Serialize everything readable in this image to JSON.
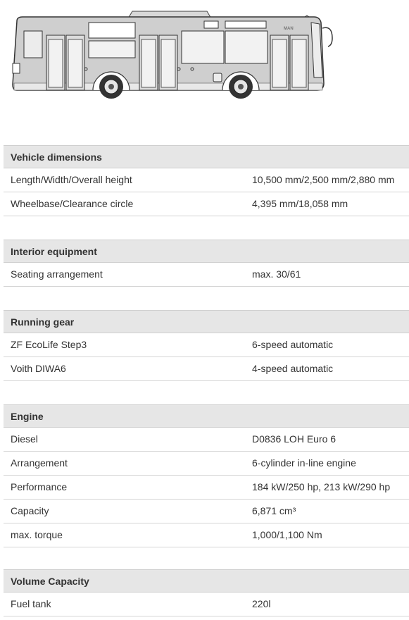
{
  "sections": [
    {
      "title": "Vehicle dimensions",
      "rows": [
        {
          "label": "Length/Width/Overall height",
          "value": "10,500 mm/2,500 mm/2,880 mm"
        },
        {
          "label": "Wheelbase/Clearance circle",
          "value": "4,395 mm/18,058 mm"
        }
      ]
    },
    {
      "title": "Interior equipment",
      "rows": [
        {
          "label": "Seating arrangement",
          "value": "max. 30/61"
        }
      ]
    },
    {
      "title": "Running gear",
      "rows": [
        {
          "label": "ZF EcoLife Step3",
          "value": "6-speed automatic"
        },
        {
          "label": "Voith DIWA6",
          "value": "4-speed automatic"
        }
      ]
    },
    {
      "title": "Engine",
      "rows": [
        {
          "label": "Diesel",
          "value": "D0836 LOH Euro 6"
        },
        {
          "label": "Arrangement",
          "value": "6-cylinder in-line engine"
        },
        {
          "label": "Performance",
          "value": "184 kW/250 hp, 213 kW/290 hp"
        },
        {
          "label": "Capacity",
          "value": "6,871 cm³"
        },
        {
          "label": "max. torque",
          "value": "1,000/1,100 Nm"
        }
      ]
    },
    {
      "title": "Volume Capacity",
      "rows": [
        {
          "label": "Fuel tank",
          "value": "220l"
        }
      ]
    }
  ],
  "bus_logo": "MAN"
}
